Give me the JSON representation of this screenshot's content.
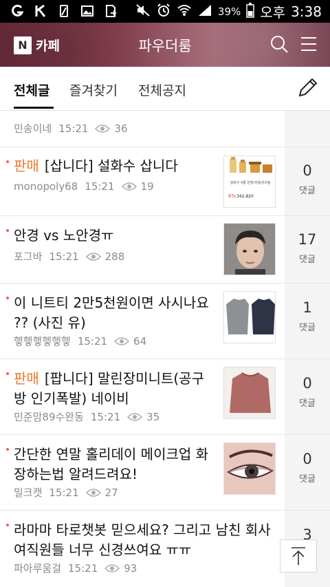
{
  "status_bar": {
    "battery_pct": "39%",
    "ampm": "오후",
    "time": "3:38"
  },
  "app_bar": {
    "brand": "카페",
    "logo_letter": "N",
    "cafe_name": "파우더룸"
  },
  "tabs": [
    {
      "label": "전체글",
      "active": true
    },
    {
      "label": "즐겨찾기",
      "active": false
    },
    {
      "label": "전체공지",
      "active": false
    }
  ],
  "posts": [
    {
      "tag": "",
      "title": "",
      "author": "민송이네",
      "time": "15:21",
      "views": "36",
      "comments": "",
      "comments_label": "",
      "thumb": "none"
    },
    {
      "tag": "판매",
      "title": "[삽니다] 설화수 삽니다",
      "author": "monopoly68",
      "time": "15:21",
      "views": "19",
      "comments": "0",
      "comments_label": "댓글",
      "thumb": "cosmetics"
    },
    {
      "tag": "",
      "title": "안경 vs 노안경ㅠ",
      "author": "포그바",
      "time": "15:21",
      "views": "288",
      "comments": "17",
      "comments_label": "댓글",
      "thumb": "person"
    },
    {
      "tag": "",
      "title": "이 니트티 2만5천원이면 사시나요 ?? (사진 유)",
      "author": "헿헿헿헿헿헿",
      "time": "15:21",
      "views": "64",
      "comments": "1",
      "comments_label": "댓글",
      "thumb": "knits"
    },
    {
      "tag": "판매",
      "title": "[팝니다] 말린장미니트(공구방 인기폭발) 네이비",
      "author": "민준맘89수완동",
      "time": "15:21",
      "views": "35",
      "comments": "0",
      "comments_label": "댓글",
      "thumb": "sweater"
    },
    {
      "tag": "",
      "title": "간단한 연말 홀리데이 메이크업 화장하는법 알려드려요!",
      "author": "밀크캣",
      "time": "15:21",
      "views": "27",
      "comments": "0",
      "comments_label": "댓글",
      "thumb": "eye"
    },
    {
      "tag": "",
      "title": "라마마 타로챗봇 믿으세요? 그리고 남친 회사 여직원들 너무 신경쓰여요 ㅠㅠ",
      "author": "파아루움걸",
      "time": "15:21",
      "views": "93",
      "comments": "3",
      "comments_label": "댓글",
      "thumb": "none"
    }
  ],
  "thumb_text": {
    "cosmetics_caption": "설화수 4종 한방/자음생크림",
    "cosmetics_discount": "6%",
    "cosmetics_price": "342,820"
  },
  "colors": {
    "tag": "#f0752a",
    "new_dot": "#ff5a4f",
    "app_bar": "#8f4456"
  }
}
